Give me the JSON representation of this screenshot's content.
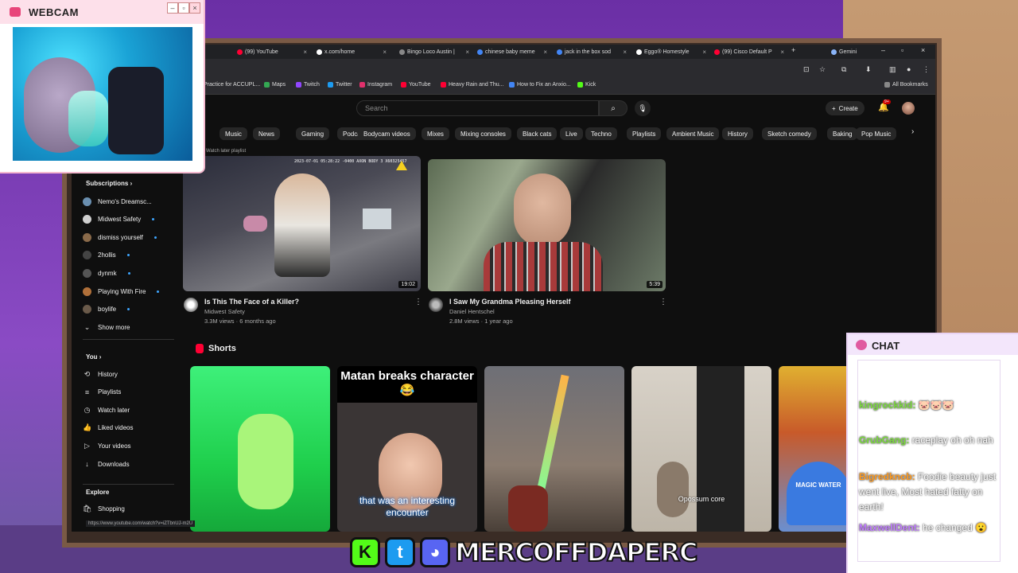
{
  "webcam": {
    "title": "WEBCAM"
  },
  "tabs": [
    {
      "label": "(99) YouTube",
      "color": "#ff0033"
    },
    {
      "label": "x.com/home",
      "color": "#ffffff"
    },
    {
      "label": "Bingo Loco Austin |",
      "color": "#888888"
    },
    {
      "label": "chinese baby meme",
      "color": "#4285f4"
    },
    {
      "label": "jack in the box sod",
      "color": "#4285f4"
    },
    {
      "label": "Eggo® Homestyle",
      "color": "#ffffff"
    },
    {
      "label": "(99) Cisco Default P",
      "color": "#ff0033"
    },
    {
      "label": "Gemini",
      "color": "#8ab4f8"
    }
  ],
  "bookmarks": [
    {
      "label": "Practice for ACCUPL...",
      "color": "#4285f4"
    },
    {
      "label": "Maps",
      "color": "#34a853"
    },
    {
      "label": "Twitch",
      "color": "#9146ff"
    },
    {
      "label": "Twitter",
      "color": "#1d9bf0"
    },
    {
      "label": "Instagram",
      "color": "#e1306c"
    },
    {
      "label": "YouTube",
      "color": "#ff0033"
    },
    {
      "label": "Heavy Rain and Thu...",
      "color": "#ff0033"
    },
    {
      "label": "How to Fix an Anxio...",
      "color": "#4285f4"
    },
    {
      "label": "Kick",
      "color": "#53fc18"
    },
    {
      "label": "All Bookmarks",
      "color": "#888888"
    }
  ],
  "search": {
    "placeholder": "Search"
  },
  "header": {
    "create": "Create",
    "bell_badge": "9+"
  },
  "chips": [
    "Music",
    "News",
    "Gaming",
    "Podcasts",
    "Bodycam videos",
    "Mixes",
    "Mixing consoles",
    "Black cats",
    "Live",
    "Techno",
    "Playlists",
    "Ambient Music",
    "History",
    "Sketch comedy",
    "Baking",
    "Pop Music"
  ],
  "sidebar": {
    "subscriptions_label": "Subscriptions",
    "subscriptions": [
      {
        "label": "Nemo's Dreamsc...",
        "color": "#6a8fb0"
      },
      {
        "label": "Midwest Safety",
        "color": "#cfcfcf"
      },
      {
        "label": "dismiss yourself",
        "color": "#8a6a4a"
      },
      {
        "label": "2hollis",
        "color": "#444444"
      },
      {
        "label": "dynmk",
        "color": "#555555"
      },
      {
        "label": "Playing With Fire",
        "color": "#b0703a"
      },
      {
        "label": "boylife",
        "color": "#6a5a4a"
      }
    ],
    "show_more": "Show more",
    "you_label": "You",
    "you_items": [
      {
        "label": "History",
        "icon": "history-icon",
        "glyph": "⟲"
      },
      {
        "label": "Playlists",
        "icon": "playlists-icon",
        "glyph": "≡"
      },
      {
        "label": "Watch later",
        "icon": "watch-later-icon",
        "glyph": "◷"
      },
      {
        "label": "Liked videos",
        "icon": "liked-icon",
        "glyph": "👍"
      },
      {
        "label": "Your videos",
        "icon": "your-videos-icon",
        "glyph": "▷"
      },
      {
        "label": "Downloads",
        "icon": "downloads-icon",
        "glyph": "↓"
      }
    ],
    "explore_label": "Explore",
    "explore_items": [
      {
        "label": "Shopping",
        "icon": "shopping-icon",
        "glyph": "🛍"
      }
    ]
  },
  "videos": [
    {
      "title": "Is This The Face of a Killer?",
      "channel": "Midwest Safety",
      "views": "3.3M views",
      "age": "6 months ago",
      "duration": "19:02",
      "overlay": "ur Watch later playlist",
      "stamp": "2023-07-01 05:28:22 -0400 AXON BODY 3 X60325457"
    },
    {
      "title": "I Saw My Grandma Pleasing Herself",
      "channel": "Daniel Hentschel",
      "views": "2.8M views",
      "age": "1 year ago",
      "duration": "5:39"
    }
  ],
  "shorts": {
    "title": "Shorts",
    "items": [
      {
        "top": "",
        "bottom": ""
      },
      {
        "top": "Matan breaks character 😂",
        "bottom": "that was an interesting encounter"
      },
      {
        "top": "",
        "bottom": ""
      },
      {
        "top": "",
        "bottom": "Opossum core"
      },
      {
        "top": "",
        "bottom": "MAGIC WATER"
      }
    ]
  },
  "status_url": "https://www.youtube.com/watch?v=iZTbnUJ-m2U",
  "chat": {
    "title": "CHAT",
    "messages": [
      {
        "user": "kingrockkid:",
        "text": " 🐷🐷🐷",
        "user_color": "#7bdc3c"
      },
      {
        "user": "GrubGang:",
        "text": " raceplay oh oh nah",
        "user_color": "#7bdc3c"
      },
      {
        "user": "Bigredknob:",
        "text": " Foodie beauty just went live, Most hated fatty on earth!",
        "user_color": "#ff9a1f"
      },
      {
        "user": "MaxwellDent:",
        "text": " he changed 😮",
        "user_color": "#c07bff"
      }
    ]
  },
  "social": {
    "handle": "MERCOFFDAPERC"
  }
}
